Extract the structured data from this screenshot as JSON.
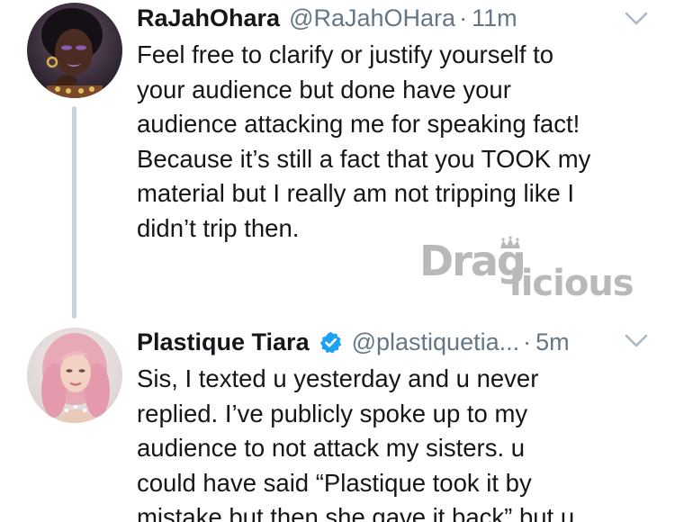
{
  "tweets": [
    {
      "display_name": "RaJahOhara",
      "handle": "@RaJahOHara",
      "separator": "·",
      "time": "11m",
      "verified": false,
      "text_lines": [
        "Feel free to clarify or justify yourself to",
        "your audience but done have your",
        "audience attacking me for speaking fact!",
        "Because it’s still a fact that you TOOK my",
        "material but I really am not tripping like I",
        "didn’t trip then."
      ]
    },
    {
      "display_name": "Plastique Tiara",
      "handle": "@plastiquetia...",
      "separator": "·",
      "time": "5m",
      "verified": true,
      "text_lines": [
        "Sis, I texted u yesterday and u never",
        "replied. I’ve publicly spoke up to my",
        "audience to not attack my sisters. u",
        "could have said “Plastique took it by",
        "mistake but then she gave it back” but u"
      ]
    }
  ],
  "watermark": {
    "text_left": "Drag",
    "text_right": "licious"
  },
  "icons": {
    "caret": "chevron-down-icon",
    "verified": "verified-badge-icon",
    "crown": "crown-icon"
  },
  "colors": {
    "name": "#14171a",
    "meta": "#657786",
    "verified": "#1da1f2",
    "thread_line": "#c9d3dc",
    "watermark": "#b9b9b9"
  }
}
